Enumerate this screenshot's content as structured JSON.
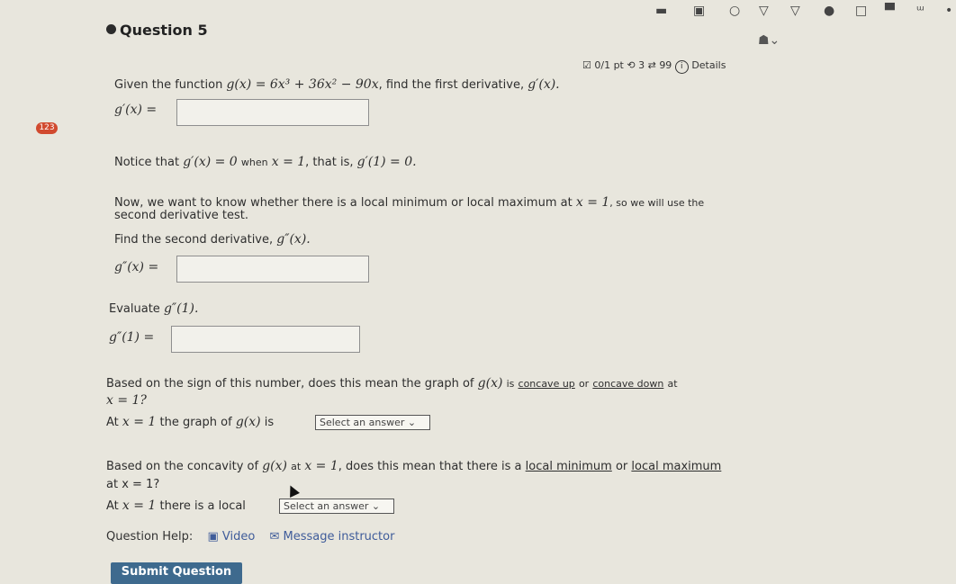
{
  "status_icons": [
    "square-icon",
    "image-icon",
    "circle-icon",
    "triangle-down-icon",
    "triangle-down-icon",
    "dot-icon",
    "square-icon",
    "bar-icon",
    "wifi-icon",
    "dot-icon"
  ],
  "question": {
    "title": "Question 5",
    "badge": "123",
    "meta": {
      "score": "0/1 pt",
      "retries": "3",
      "attempts": "99",
      "details": "Details"
    }
  },
  "content": {
    "p1_text": "Given the function",
    "p1_func": "g(x) = 6x³ + 36x² − 90x",
    "p1_tail": ", find the first derivative,",
    "p1_deriv": "g′(x).",
    "p1_label": "g′(x) =",
    "p2_text": "Notice that",
    "p2_expr": "g′(x) = 0",
    "p2_when": "when",
    "p2_x": "x = 1",
    "p2_thatis": ", that is,",
    "p2_val": "g′(1) = 0.",
    "p3_line1": "Now, we want to know whether there is a local minimum or local maximum at",
    "p3_x": "x = 1",
    "p3_line1_tail": ", so we will use the",
    "p3_line2": "second derivative test.",
    "p4_text": "Find the second derivative,",
    "p4_expr": "g″(x).",
    "p4_label": "g″(x) =",
    "p5_text": "Evaluate",
    "p5_expr": "g″(1).",
    "p5_label": "g″(1) =",
    "p6_line1a": "Based on the sign of this number, does this mean the graph of",
    "p6_g": "g(x)",
    "p6_line1b": "is",
    "p6_up": "concave up",
    "p6_or": "or",
    "p6_down": "concave down",
    "p6_at": "at",
    "p6_line2": "x = 1?",
    "p7_at": "At",
    "p7_x": "x = 1",
    "p7_text": "the graph of",
    "p7_g": "g(x)",
    "p7_is": "is",
    "select1": "Select an answer",
    "p8_line1a": "Based on the concavity of",
    "p8_g": "g(x)",
    "p8_at": "at",
    "p8_x": "x = 1",
    "p8_line1b": ", does this mean that there is a",
    "p8_min": "local minimum",
    "p8_or": "or",
    "p8_max": "local maximum",
    "p8_line2": "at x = 1?",
    "p9_at": "At",
    "p9_x": "x = 1",
    "p9_text": "there is a local",
    "select2": "Select an answer"
  },
  "help": {
    "label": "Question Help:",
    "video": "Video",
    "message": "Message instructor"
  },
  "submit_label": "Submit Question"
}
